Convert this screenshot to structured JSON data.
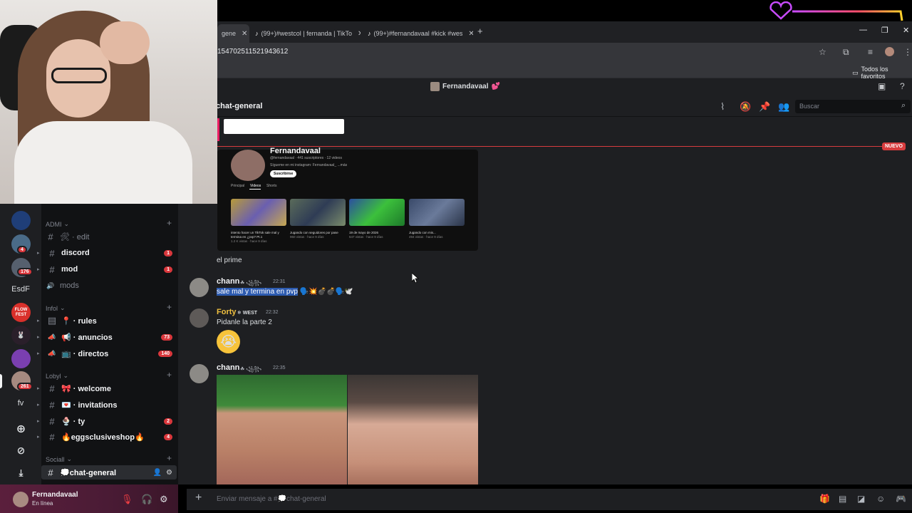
{
  "browser": {
    "tabs": [
      {
        "label": "gene",
        "active": true
      },
      {
        "label": "(99+)#westcol | fernanda | TikTo",
        "icon": "tiktok-icon"
      },
      {
        "label": "(99+)#fernandavaal #kick #wes",
        "icon": "tiktok-icon"
      }
    ],
    "url": "154702511521943612",
    "bookmarks_label": "Todos los favoritos"
  },
  "discord": {
    "title": "Fernandavaal",
    "title_heart": "💕",
    "guilds": [
      {
        "badge": ""
      },
      {
        "badge": "4"
      },
      {
        "badge": "176"
      },
      {
        "text": "EsdF"
      },
      {
        "label": "FLOW FEST"
      },
      {
        "badge": ""
      },
      {
        "badge": ""
      },
      {
        "badge": "261"
      },
      {
        "text": "fv"
      }
    ],
    "categories": [
      {
        "name": "ADMI"
      },
      {
        "name": "Infol"
      },
      {
        "name": "Lobyl"
      },
      {
        "name": "Sociall"
      }
    ],
    "channels": [
      {
        "name": "🛠 · edit",
        "icon": "#",
        "muted": true
      },
      {
        "name": "discord",
        "icon": "#",
        "badge": "1",
        "bold": true
      },
      {
        "name": "mod",
        "icon": "#",
        "badge": "1",
        "bold": true
      },
      {
        "name": "mods",
        "icon": "🔊",
        "muted": true
      },
      {
        "name": "📍 · rules",
        "icon": "▤",
        "bold": true
      },
      {
        "name": "📢 · anuncios",
        "icon": "📣",
        "badge": "73",
        "bold": true
      },
      {
        "name": "📺 · directos",
        "icon": "📣",
        "badge": "140",
        "bold": true
      },
      {
        "name": "🎀 · welcome",
        "icon": "#",
        "bold": true
      },
      {
        "name": "💌 · invitations",
        "icon": "#",
        "bold": true
      },
      {
        "name": "🍨 · ty",
        "icon": "#",
        "badge": "2",
        "bold": true
      },
      {
        "name": "🔥eggsclusiveshop🔥",
        "icon": "#",
        "badge": "4",
        "bold": true
      },
      {
        "name": "💭chat-general",
        "icon": "#",
        "active": true
      }
    ],
    "user": {
      "name": "Fernandavaal",
      "status": "En línea"
    },
    "channel_header": "chat-general",
    "search_placeholder": "Buscar",
    "new_label": "NUEVO",
    "input_placeholder": "Enviar mensaje a #💭chat-general"
  },
  "embed": {
    "name": "Fernandavaal",
    "meta": "@fernandavaal · 441 suscriptores · 12 videos",
    "desc": "Sígueme en mi instagram: Fernandavaal_ ...más",
    "subscribe": "Suscribirse",
    "tabs": [
      "Principal",
      "Videos",
      "Shorts"
    ],
    "videos": [
      {
        "title": "intento hacer un TikTok sale mal y termina en ¿pvp? Pt.1",
        "stats": "1.2 K vistas · hace 9 días"
      },
      {
        "title": "Jugando con seguidores por pase",
        "stats": "960 vistas · hace 9 días"
      },
      {
        "title": "19 de mayo de 2026",
        "stats": "647 vistas · hace 9 días"
      },
      {
        "title": "Jugando con mis...",
        "stats": "494 vistas · hace 9 días"
      }
    ]
  },
  "messages": [
    {
      "text": "el prime"
    },
    {
      "author": "chann",
      "tag": "☘ ꧁꧂",
      "time": "22:31",
      "text": "sale mal y termina en pvp",
      "emojis": "🗣️💥💣💣🗣️🕊️"
    },
    {
      "author": "Forty",
      "tag": "❄ WEST",
      "time": "22:32",
      "text": "Pidanle la parte 2",
      "emoji": "😭"
    },
    {
      "author": "chann",
      "tag": "☘ ꧁꧂",
      "time": "22:35"
    }
  ]
}
